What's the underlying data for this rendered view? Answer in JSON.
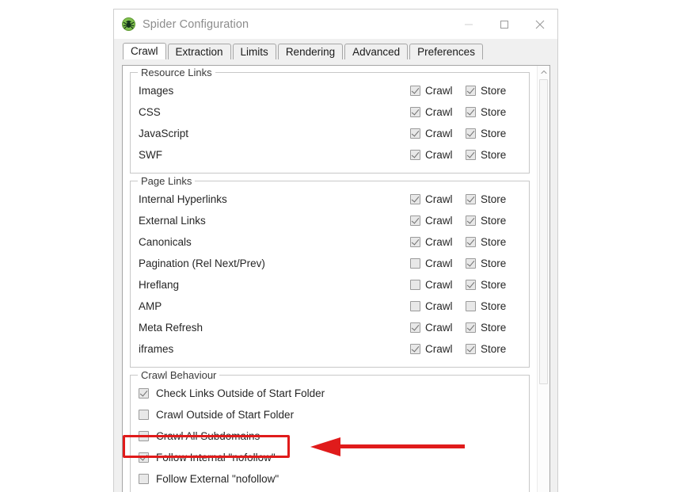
{
  "window": {
    "title": "Spider Configuration",
    "icon": "spider-logo-icon",
    "controls": {
      "minimize": "minimize-icon",
      "maximize": "maximize-icon",
      "close": "close-icon"
    }
  },
  "tabs": [
    {
      "label": "Crawl",
      "active": true
    },
    {
      "label": "Extraction",
      "active": false
    },
    {
      "label": "Limits",
      "active": false
    },
    {
      "label": "Rendering",
      "active": false
    },
    {
      "label": "Advanced",
      "active": false
    },
    {
      "label": "Preferences",
      "active": false
    }
  ],
  "columns": {
    "crawl": "Crawl",
    "store": "Store"
  },
  "groups": [
    {
      "title": "Resource Links",
      "rows": [
        {
          "label": "Images",
          "crawl": true,
          "store": true
        },
        {
          "label": "CSS",
          "crawl": true,
          "store": true
        },
        {
          "label": "JavaScript",
          "crawl": true,
          "store": true
        },
        {
          "label": "SWF",
          "crawl": true,
          "store": true
        }
      ]
    },
    {
      "title": "Page Links",
      "rows": [
        {
          "label": "Internal Hyperlinks",
          "crawl": true,
          "store": true
        },
        {
          "label": "External Links",
          "crawl": true,
          "store": true
        },
        {
          "label": "Canonicals",
          "crawl": true,
          "store": true
        },
        {
          "label": "Pagination (Rel Next/Prev)",
          "crawl": false,
          "store": true
        },
        {
          "label": "Hreflang",
          "crawl": false,
          "store": true
        },
        {
          "label": "AMP",
          "crawl": false,
          "store": false
        },
        {
          "label": "Meta Refresh",
          "crawl": true,
          "store": true
        },
        {
          "label": "iframes",
          "crawl": true,
          "store": true
        }
      ]
    }
  ],
  "behaviour": {
    "title": "Crawl Behaviour",
    "rows": [
      {
        "label": "Check Links Outside of Start Folder",
        "checked": true
      },
      {
        "label": "Crawl Outside of Start Folder",
        "checked": false
      },
      {
        "label": "Crawl All Subdomains",
        "checked": false
      },
      {
        "label": "Follow Internal \"nofollow\"",
        "checked": true
      },
      {
        "label": "Follow External \"nofollow\"",
        "checked": false
      }
    ]
  },
  "scrollbar": {
    "up_arrow": "scroll-up-arrow-icon",
    "thumb": "scroll-thumb"
  },
  "annotation": {
    "highlight_color": "#e01b1b",
    "target_label": "Follow Internal \"nofollow\"",
    "arrow": "left-pointing-arrow"
  }
}
